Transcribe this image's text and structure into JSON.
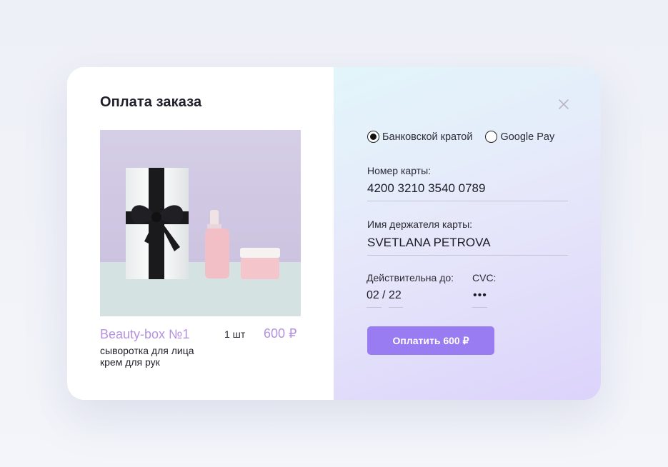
{
  "order": {
    "title": "Оплата заказа",
    "product": {
      "name": "Beauty-box №1",
      "quantity": "1 шт",
      "price": "600 ₽",
      "items": [
        "сыворотка для лица",
        "крем для рук"
      ],
      "image": "gift-box-with-serum-and-cream-image"
    }
  },
  "payment": {
    "methods": [
      {
        "label": "Банковской кратой",
        "selected": true
      },
      {
        "label": "Google Pay",
        "selected": false
      }
    ],
    "card_number_label": "Номер карты:",
    "card_number_value": "4200 3210 3540 0789",
    "holder_label": "Имя держателя карты:",
    "holder_value": "SVETLANA PETROVA",
    "expiry_label": "Действительна до:",
    "expiry_month": "02",
    "expiry_separator": "/",
    "expiry_year": "22",
    "cvc_label": "CVC:",
    "cvc_value": "•••",
    "pay_button": "Оплатить 600 ₽",
    "close_icon": "close-icon"
  },
  "colors": {
    "accent": "#9a7cf2",
    "product_accent": "#b492e0",
    "left_bg": "#ffffff",
    "right_bg_start": "#e2f6fa",
    "right_bg_end": "#dcd3fb"
  }
}
